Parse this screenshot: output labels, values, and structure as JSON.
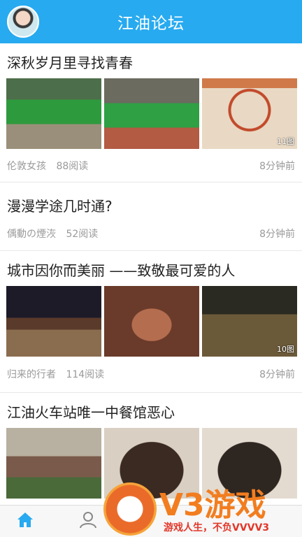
{
  "header": {
    "title": "江油论坛"
  },
  "posts": [
    {
      "title": "深秋岁月里寻找青春",
      "author": "伦敦女孩",
      "reads": "88阅读",
      "time": "8分钟前",
      "image_count": "11图"
    },
    {
      "title": "漫漫学途几时通?",
      "author": "偊動の煙洃",
      "reads": "52阅读",
      "time": "8分钟前"
    },
    {
      "title": "城市因你而美丽 ——致敬最可爱的人",
      "author": "归来的行者",
      "reads": "114阅读",
      "time": "8分钟前",
      "image_count": "10图"
    },
    {
      "title": "江油火车站唯一中餐馆恶心"
    }
  ],
  "tabbar": {
    "items": [
      "home",
      "forum"
    ]
  },
  "watermark": {
    "text": "V3游戏",
    "sub": "游戏人生，不负VVVV3"
  },
  "colors": {
    "header": "#27aaf0",
    "tab_active": "#27aaf0",
    "watermark": "#f27d1f"
  }
}
